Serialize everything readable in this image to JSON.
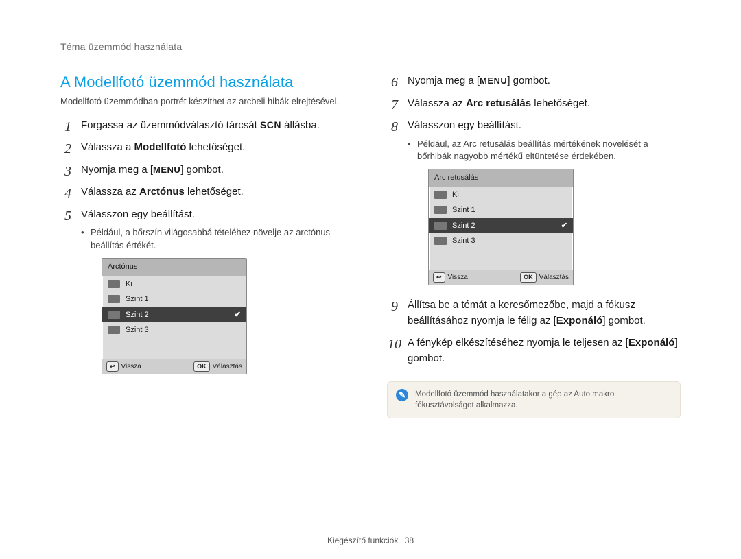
{
  "running_head": "Téma üzemmód használata",
  "heading": "A Modellfotó üzemmód használata",
  "intro": "Modellfotó üzemmódban portrét készíthet az arcbeli hibák elrejtésével.",
  "glyphs": {
    "scn": "SCN",
    "menu": "MENU"
  },
  "left_steps": {
    "s1_a": "Forgassa az üzemmódválasztó tárcsát ",
    "s1_b": " állásba.",
    "s2_a": "Válassza a ",
    "s2_bold": "Modellfotó",
    "s2_b": " lehetőséget.",
    "s3_a": "Nyomja meg a [",
    "s3_b": "] gombot.",
    "s4_a": "Válassza az ",
    "s4_bold": "Arctónus",
    "s4_b": " lehetőséget.",
    "s5": "Válasszon egy beállítást.",
    "s5_sub": "Például, a bőrszín világosabbá tételéhez növelje az arctónus beállítás értékét."
  },
  "right_steps": {
    "s6_a": "Nyomja meg a [",
    "s6_b": "] gombot.",
    "s7_a": "Válassza az ",
    "s7_bold": "Arc retusálás",
    "s7_b": " lehetőséget.",
    "s8": "Válasszon egy beállítást.",
    "s8_sub": "Például, az Arc retusálás beállítás mértékének növelését a bőrhibák nagyobb mértékű eltüntetése érdekében.",
    "s9_a": "Állítsa be a témát a keresőmezőbe, majd a fókusz beállításához nyomja le félig az [",
    "s9_bold": "Exponáló",
    "s9_b": "] gombot.",
    "s10_a": "A fénykép elkészítéséhez nyomja le teljesen az [",
    "s10_bold": "Exponáló",
    "s10_b": "] gombot."
  },
  "lcd_left": {
    "title": "Arctónus",
    "items": [
      "Ki",
      "Szint 1",
      "Szint 2",
      "Szint 3"
    ],
    "selected_index": 2,
    "back_key": "↩",
    "back_label": "Vissza",
    "ok_key": "OK",
    "ok_label": "Választás"
  },
  "lcd_right": {
    "title": "Arc retusálás",
    "items": [
      "Ki",
      "Szint 1",
      "Szint 2",
      "Szint 3"
    ],
    "selected_index": 2,
    "back_key": "↩",
    "back_label": "Vissza",
    "ok_key": "OK",
    "ok_label": "Választás"
  },
  "note": "Modellfotó üzemmód használatakor a gép az Auto makro fókusztávolságot alkalmazza.",
  "footer": {
    "section": "Kiegészítő funkciók",
    "page": "38"
  }
}
